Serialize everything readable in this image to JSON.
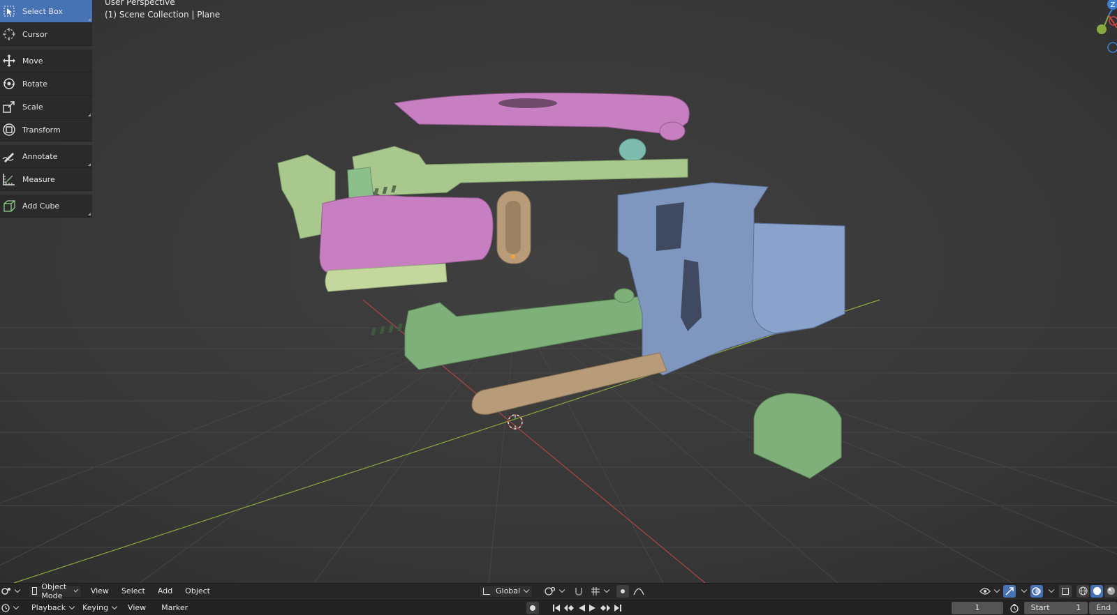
{
  "viewport": {
    "perspective_label": "User Perspective",
    "collection_label": "(1) Scene Collection | Plane"
  },
  "toolbar": {
    "groups": [
      [
        {
          "label": "Select Box",
          "icon": "select-box-icon",
          "active": true
        },
        {
          "label": "Cursor",
          "icon": "cursor-icon"
        }
      ],
      [
        {
          "label": "Move",
          "icon": "move-icon"
        },
        {
          "label": "Rotate",
          "icon": "rotate-icon"
        },
        {
          "label": "Scale",
          "icon": "scale-icon"
        },
        {
          "label": "Transform",
          "icon": "transform-icon"
        }
      ],
      [
        {
          "label": "Annotate",
          "icon": "annotate-icon"
        },
        {
          "label": "Measure",
          "icon": "measure-icon"
        }
      ],
      [
        {
          "label": "Add Cube",
          "icon": "add-cube-icon"
        }
      ]
    ]
  },
  "gizmo": {
    "z_label": "Z"
  },
  "header": {
    "mode": "Object Mode",
    "menus": [
      "View",
      "Select",
      "Add",
      "Object"
    ],
    "orientation": "Global"
  },
  "timeline": {
    "menus": [
      "Playback",
      "Keying",
      "View",
      "Marker"
    ],
    "current_frame": "1",
    "start_label": "Start",
    "start_value": "1",
    "end_label": "End"
  },
  "colors": {
    "pink": "#c77fc1",
    "green": "#7fb07a",
    "lightgreen": "#a9c88d",
    "blue": "#7f96bf",
    "tan": "#b89c7a",
    "teal": "#7fbcb0",
    "accent": "#4772b3"
  }
}
